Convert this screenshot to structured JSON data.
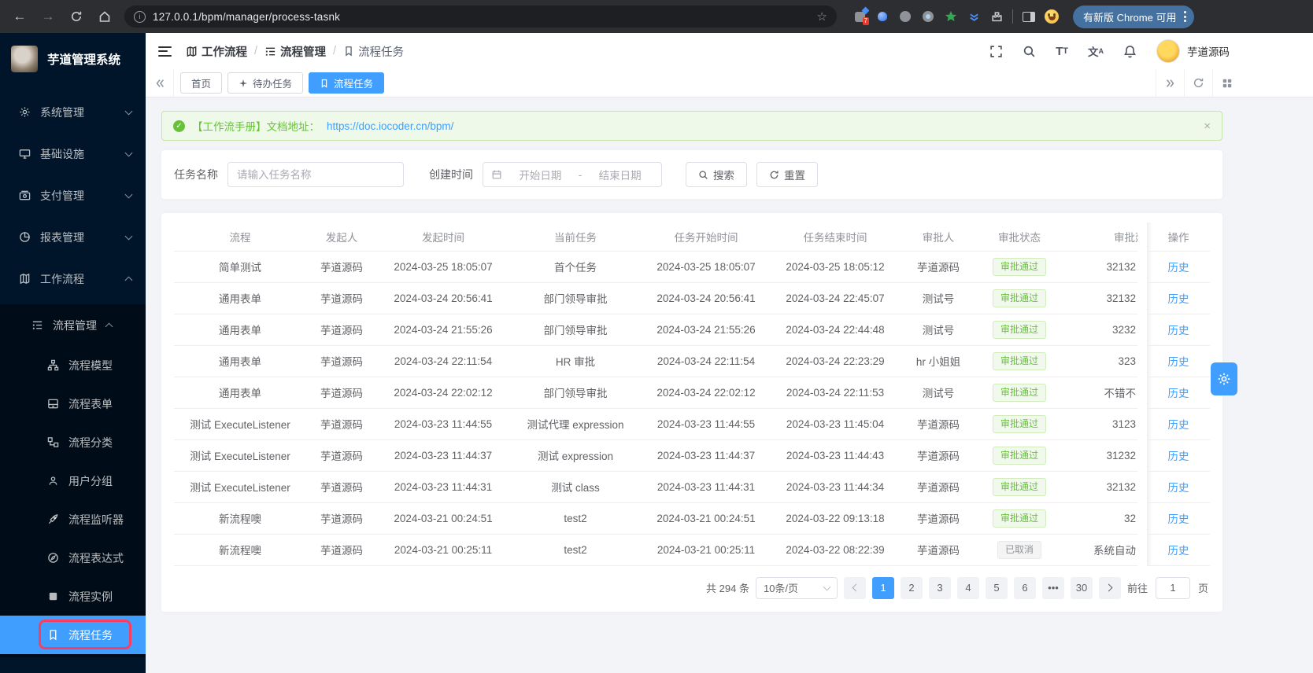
{
  "browser": {
    "url": "127.0.0.1/bpm/manager/process-tasnk",
    "update_chip": "有新版 Chrome 可用",
    "extension_badge": "7"
  },
  "sidebar": {
    "app_title": "芋道管理系统",
    "menu": [
      {
        "label": "系统管理",
        "icon": "gear"
      },
      {
        "label": "基础设施",
        "icon": "monitor"
      },
      {
        "label": "支付管理",
        "icon": "payment"
      },
      {
        "label": "报表管理",
        "icon": "report"
      },
      {
        "label": "工作流程",
        "icon": "workflow",
        "expanded": true
      }
    ],
    "submenu_parent": {
      "label": "流程管理",
      "expanded": true
    },
    "submenu": [
      {
        "label": "流程模型",
        "icon": "model"
      },
      {
        "label": "流程表单",
        "icon": "form"
      },
      {
        "label": "流程分类",
        "icon": "category"
      },
      {
        "label": "用户分组",
        "icon": "user-group"
      },
      {
        "label": "流程监听器",
        "icon": "listener"
      },
      {
        "label": "流程表达式",
        "icon": "expression"
      },
      {
        "label": "流程实例",
        "icon": "instance"
      },
      {
        "label": "流程任务",
        "icon": "bookmark",
        "active": true
      }
    ]
  },
  "header": {
    "breadcrumb": [
      "工作流程",
      "流程管理",
      "流程任务"
    ],
    "user_name": "芋道源码"
  },
  "tabs": [
    {
      "label": "首页"
    },
    {
      "label": "待办任务"
    },
    {
      "label": "流程任务",
      "active": true
    }
  ],
  "alert": {
    "text": "【工作流手册】文档地址：",
    "link": "https://doc.iocoder.cn/bpm/",
    "close": "×"
  },
  "filters": {
    "task_name_label": "任务名称",
    "task_name_placeholder": "请输入任务名称",
    "create_time_label": "创建时间",
    "start_placeholder": "开始日期",
    "range_separator": "-",
    "end_placeholder": "结束日期",
    "search_label": "搜索",
    "reset_label": "重置"
  },
  "table": {
    "columns": [
      "流程",
      "发起人",
      "发起时间",
      "当前任务",
      "任务开始时间",
      "任务结束时间",
      "审批人",
      "审批状态",
      "审批建议",
      "操作"
    ],
    "action_label": "历史",
    "rows": [
      {
        "process": "简单测试",
        "starter": "芋道源码",
        "start_time": "2024-03-25 18:05:07",
        "task": "首个任务",
        "task_start": "2024-03-25 18:05:07",
        "task_end": "2024-03-25 18:05:12",
        "approver": "芋道源码",
        "status": "审批通过",
        "status_type": "success",
        "opinion": "32132"
      },
      {
        "process": "通用表单",
        "starter": "芋道源码",
        "start_time": "2024-03-24 20:56:41",
        "task": "部门领导审批",
        "task_start": "2024-03-24 20:56:41",
        "task_end": "2024-03-24 22:45:07",
        "approver": "测试号",
        "status": "审批通过",
        "status_type": "success",
        "opinion": "32132"
      },
      {
        "process": "通用表单",
        "starter": "芋道源码",
        "start_time": "2024-03-24 21:55:26",
        "task": "部门领导审批",
        "task_start": "2024-03-24 21:55:26",
        "task_end": "2024-03-24 22:44:48",
        "approver": "测试号",
        "status": "审批通过",
        "status_type": "success",
        "opinion": "3232"
      },
      {
        "process": "通用表单",
        "starter": "芋道源码",
        "start_time": "2024-03-24 22:11:54",
        "task": "HR 审批",
        "task_start": "2024-03-24 22:11:54",
        "task_end": "2024-03-24 22:23:29",
        "approver": "hr 小姐姐",
        "status": "审批通过",
        "status_type": "success",
        "opinion": "323"
      },
      {
        "process": "通用表单",
        "starter": "芋道源码",
        "start_time": "2024-03-24 22:02:12",
        "task": "部门领导审批",
        "task_start": "2024-03-24 22:02:12",
        "task_end": "2024-03-24 22:11:53",
        "approver": "测试号",
        "status": "审批通过",
        "status_type": "success",
        "opinion": "不错不"
      },
      {
        "process": "测试 ExecuteListener",
        "starter": "芋道源码",
        "start_time": "2024-03-23 11:44:55",
        "task": "测试代理 expression",
        "task_start": "2024-03-23 11:44:55",
        "task_end": "2024-03-23 11:45:04",
        "approver": "芋道源码",
        "status": "审批通过",
        "status_type": "success",
        "opinion": "3123"
      },
      {
        "process": "测试 ExecuteListener",
        "starter": "芋道源码",
        "start_time": "2024-03-23 11:44:37",
        "task": "测试 expression",
        "task_start": "2024-03-23 11:44:37",
        "task_end": "2024-03-23 11:44:43",
        "approver": "芋道源码",
        "status": "审批通过",
        "status_type": "success",
        "opinion": "31232"
      },
      {
        "process": "测试 ExecuteListener",
        "starter": "芋道源码",
        "start_time": "2024-03-23 11:44:31",
        "task": "测试 class",
        "task_start": "2024-03-23 11:44:31",
        "task_end": "2024-03-23 11:44:34",
        "approver": "芋道源码",
        "status": "审批通过",
        "status_type": "success",
        "opinion": "32132"
      },
      {
        "process": "新流程噢",
        "starter": "芋道源码",
        "start_time": "2024-03-21 00:24:51",
        "task": "test2",
        "task_start": "2024-03-21 00:24:51",
        "task_end": "2024-03-22 09:13:18",
        "approver": "芋道源码",
        "status": "审批通过",
        "status_type": "success",
        "opinion": "32"
      },
      {
        "process": "新流程噢",
        "starter": "芋道源码",
        "start_time": "2024-03-21 00:25:11",
        "task": "test2",
        "task_start": "2024-03-21 00:25:11",
        "task_end": "2024-03-22 08:22:39",
        "approver": "芋道源码",
        "status": "已取消",
        "status_type": "info",
        "opinion": "系统自动"
      }
    ]
  },
  "pagination": {
    "total": "共 294 条",
    "page_size": "10条/页",
    "pages": [
      "1",
      "2",
      "3",
      "4",
      "5",
      "6"
    ],
    "active_page": "1",
    "more": "•••",
    "last_page": "30",
    "goto_label": "前往",
    "goto_value": "1",
    "goto_suffix": "页"
  },
  "colors": {
    "primary": "#409eff",
    "success": "#67c23a",
    "sidebar_bg": "#001529",
    "annotation": "#f73e63"
  }
}
